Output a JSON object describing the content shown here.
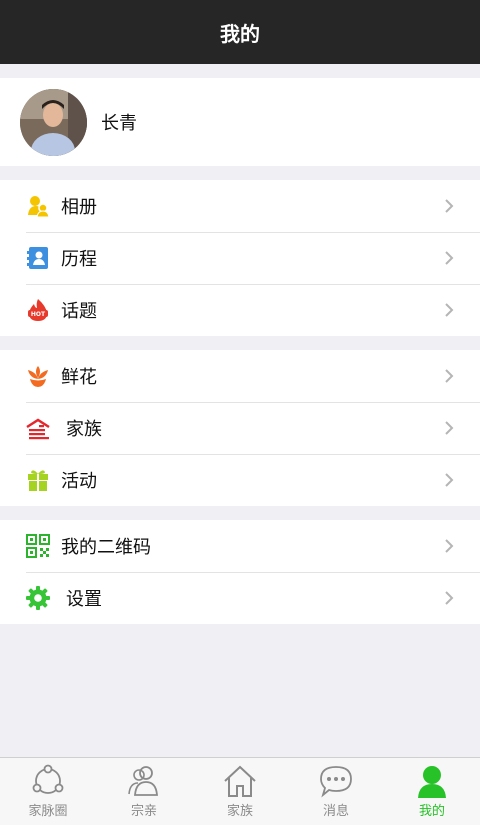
{
  "header": {
    "title": "我的"
  },
  "profile": {
    "name": "长青"
  },
  "groups": [
    {
      "items": [
        {
          "label": "相册",
          "icon": "album-icon"
        },
        {
          "label": "历程",
          "icon": "history-icon"
        },
        {
          "label": "话题",
          "icon": "hot-topic-icon"
        }
      ]
    },
    {
      "items": [
        {
          "label": "鲜花",
          "icon": "flower-icon"
        },
        {
          "label": "家族",
          "icon": "family-icon"
        },
        {
          "label": "活动",
          "icon": "gift-icon"
        }
      ]
    },
    {
      "items": [
        {
          "label": "我的二维码",
          "icon": "qr-code-icon"
        },
        {
          "label": "设置",
          "icon": "gear-icon"
        }
      ]
    }
  ],
  "tabbar": [
    {
      "label": "家脉圈",
      "icon": "share-network-icon",
      "active": false
    },
    {
      "label": "宗亲",
      "icon": "contacts-icon",
      "active": false
    },
    {
      "label": "家族",
      "icon": "home-icon",
      "active": false
    },
    {
      "label": "消息",
      "icon": "message-icon",
      "active": false
    },
    {
      "label": "我的",
      "icon": "person-icon",
      "active": true
    }
  ],
  "colors": {
    "accent": "#27c227",
    "nav_bg": "#262626"
  }
}
